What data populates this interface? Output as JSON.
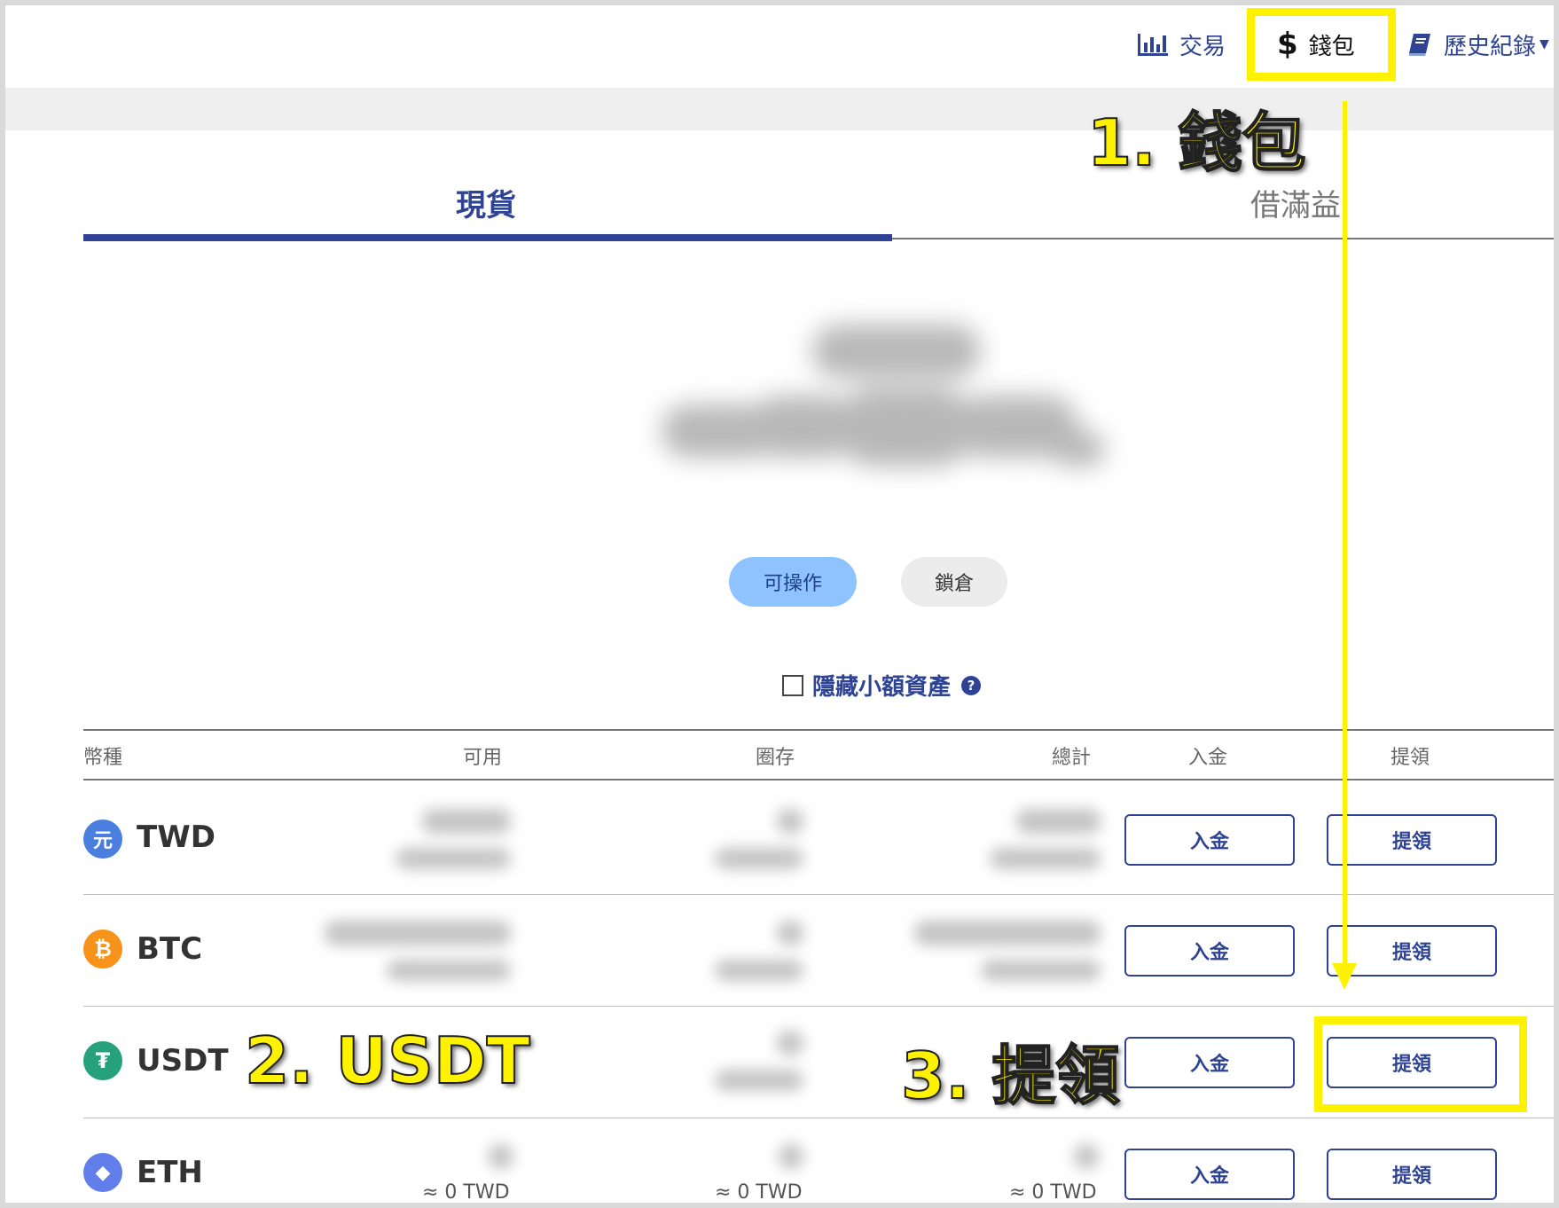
{
  "nav": {
    "trade_label": "交易",
    "wallet_label": "錢包",
    "history_label": "歷史紀錄"
  },
  "tabs": {
    "spot": "現貨",
    "margin": "借滿益"
  },
  "toggles": {
    "available": "可操作",
    "locked": "鎖倉"
  },
  "hide_small_label": "隱藏小額資產",
  "table": {
    "headers": {
      "currency": "幣種",
      "available": "可用",
      "in_orders": "圈存",
      "total": "總計",
      "deposit": "入金",
      "withdraw": "提領"
    },
    "rows": [
      {
        "coin": "TWD",
        "icon_glyph": "元",
        "color": "#4a7fe0",
        "deposit": "入金",
        "withdraw": "提領"
      },
      {
        "coin": "BTC",
        "icon_glyph": "₿",
        "color": "#f7931a",
        "deposit": "入金",
        "withdraw": "提領"
      },
      {
        "coin": "USDT",
        "icon_glyph": "₮",
        "color": "#26a17b",
        "deposit": "入金",
        "withdraw": "提領"
      },
      {
        "coin": "ETH",
        "icon_glyph": "◆",
        "color": "#627eea",
        "deposit": "入金",
        "withdraw": "提領",
        "available_approx": "≈ 0 TWD",
        "in_orders_approx": "≈ 0 TWD",
        "total_approx": "≈ 0 TWD"
      }
    ]
  },
  "annotations": {
    "step1": "1. 錢包",
    "step2": "2.  USDT",
    "step3": "3. 提領",
    "highlight_color": "#fff200"
  },
  "colors": {
    "brand": "#2e4393",
    "pill_active": "#8ec3ff"
  }
}
